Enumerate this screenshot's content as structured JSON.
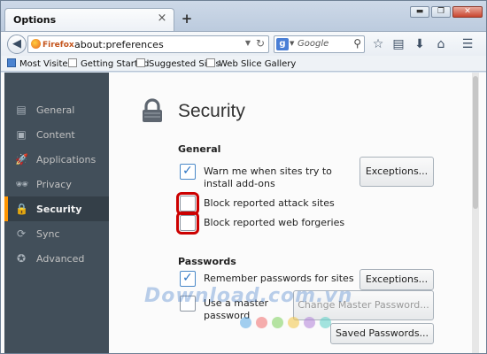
{
  "window": {
    "tab_title": "Options",
    "tab_close": "×",
    "new_tab": "+",
    "controls": [
      "▬",
      "❐",
      "✕"
    ]
  },
  "navbar": {
    "identity_label": "Firefox",
    "url": "about:preferences",
    "search_engine_icon": "g",
    "search_placeholder": "Google",
    "icons": [
      "back-icon",
      "star-icon",
      "reading-list-icon",
      "download-icon",
      "home-icon",
      "menu-icon"
    ]
  },
  "bookmarks": [
    {
      "label": "Most Visited",
      "icon": "blue"
    },
    {
      "label": "Getting Started",
      "icon": "page"
    },
    {
      "label": "Suggested Sites",
      "icon": "page"
    },
    {
      "label": "Web Slice Gallery",
      "icon": "page"
    }
  ],
  "sidebar": {
    "items": [
      {
        "label": "General",
        "icon": "general-icon",
        "glyph": "▤"
      },
      {
        "label": "Content",
        "icon": "content-icon",
        "glyph": "▣"
      },
      {
        "label": "Applications",
        "icon": "applications-icon",
        "glyph": "🚀"
      },
      {
        "label": "Privacy",
        "icon": "privacy-icon",
        "glyph": "🕶"
      },
      {
        "label": "Security",
        "icon": "security-icon",
        "glyph": "🔒"
      },
      {
        "label": "Sync",
        "icon": "sync-icon",
        "glyph": "⟳"
      },
      {
        "label": "Advanced",
        "icon": "advanced-icon",
        "glyph": "✪"
      }
    ],
    "active": "Security"
  },
  "main": {
    "title": "Security",
    "general_title": "General",
    "warn_addons_line1": "Warn me when sites try to",
    "warn_addons_line2": "install add-ons",
    "warn_addons_checked": true,
    "exceptions_label": "Exceptions...",
    "block_attack": "Block reported attack sites",
    "block_attack_checked": false,
    "block_forgeries": "Block reported web forgeries",
    "block_forgeries_checked": false,
    "passwords_title": "Passwords",
    "remember_passwords": "Remember passwords for sites",
    "remember_passwords_checked": true,
    "exceptions2_label": "Exceptions...",
    "master_line1": "Use a master",
    "master_line2": "password",
    "master_checked": false,
    "change_master": "Change Master Password...",
    "saved_passwords": "Saved Passwords..."
  },
  "watermark": "Download.com.vn",
  "colors": {
    "sidebar_bg": "#424f5a",
    "active_accent": "#ff9500",
    "highlight": "#cc0000",
    "checkbox_check": "#2c75c4"
  }
}
